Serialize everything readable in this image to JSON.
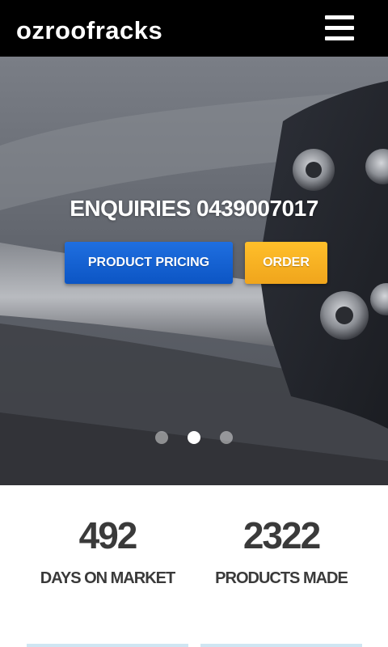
{
  "header": {
    "brand": "ozroofracks",
    "menu_icon": "hamburger-menu-icon"
  },
  "hero": {
    "title": "ENQUIRIES 0439007017",
    "buttons": {
      "pricing_label": "PRODUCT PRICING",
      "order_label": "ORDER"
    },
    "slide_count": 3,
    "active_slide": 2
  },
  "stats": [
    {
      "value": "492",
      "label": "DAYS ON MARKET"
    },
    {
      "value": "2322",
      "label": "PRODUCTS MADE"
    }
  ],
  "colors": {
    "header_bg": "#000000",
    "pricing_button": "#1565d8",
    "order_button": "#f7b024",
    "stat_text": "#3a3a3a"
  }
}
